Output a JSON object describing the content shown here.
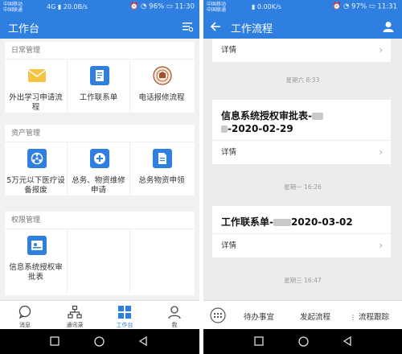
{
  "left_phone": {
    "status": {
      "carrier1": "中国移动",
      "carrier2": "中国联通",
      "net": "4G",
      "speed": "20.0B/s",
      "battery": "96%",
      "time": "11:30"
    },
    "header": {
      "title": "工作台"
    },
    "sections": [
      {
        "title": "日常管理",
        "items": [
          {
            "label": "外出学习申请流程",
            "icon": "envelope-icon"
          },
          {
            "label": "工作联系单",
            "icon": "document-icon"
          },
          {
            "label": "电话报修流程",
            "icon": "school-seal-icon"
          }
        ]
      },
      {
        "title": "资产管理",
        "items": [
          {
            "label": "5万元以下医疗设备报废",
            "icon": "fan-icon"
          },
          {
            "label": "总务、物资维修申请",
            "icon": "plus-circle-icon"
          },
          {
            "label": "总务物资申领",
            "icon": "form-icon"
          }
        ]
      },
      {
        "title": "权限管理",
        "items": [
          {
            "label": "信息系统授权审批表",
            "icon": "id-card-icon"
          }
        ]
      }
    ],
    "tabs": [
      {
        "label": "消息",
        "icon": "chat-icon"
      },
      {
        "label": "通讯录",
        "icon": "org-chart-icon"
      },
      {
        "label": "工作台",
        "icon": "grid-icon"
      },
      {
        "label": "我",
        "icon": "person-icon"
      }
    ],
    "colors": {
      "primary": "#2f7fe0",
      "tab_active": "#2f7fe0"
    }
  },
  "right_phone": {
    "status": {
      "carrier1": "中国移动",
      "carrier2": "中国联通",
      "speed": "0.00K/s",
      "battery": "97%",
      "time": "11:31"
    },
    "header": {
      "title": "工作流程"
    },
    "items": [
      {
        "detail": "详情"
      },
      {
        "time": "星期六 8:33",
        "title": "信息系统授权审批表-",
        "date": "-2020-02-29",
        "detail": "详情"
      },
      {
        "time": "星期一 16:26",
        "title": "工作联系单-",
        "date": "2020-03-02",
        "detail": "详情"
      },
      {
        "time": "星期三 16:47"
      }
    ],
    "bottom": {
      "pending": "待办事宜",
      "start": "发起流程",
      "track": "流程跟踪"
    }
  }
}
